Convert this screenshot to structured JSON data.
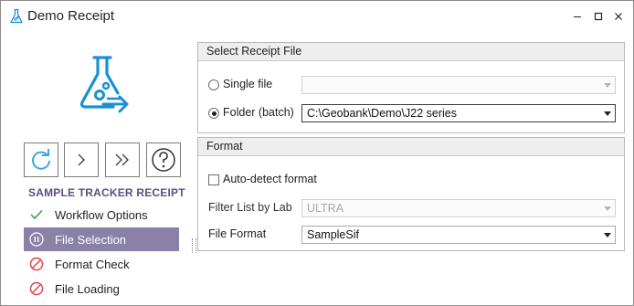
{
  "window": {
    "title": "Demo Receipt",
    "icon": "flask-icon",
    "controls": [
      "minimize",
      "maximize",
      "close"
    ]
  },
  "sidebar": {
    "toolbar_icons": [
      "refresh-icon",
      "next-icon",
      "fast-forward-icon",
      "help-icon"
    ],
    "section_title": "SAMPLE TRACKER RECEIPT",
    "steps": [
      {
        "label": "Workflow Options",
        "status": "done",
        "icon": "checkmark-icon"
      },
      {
        "label": "File Selection",
        "status": "active",
        "icon": "pause-icon"
      },
      {
        "label": "Format Check",
        "status": "blocked",
        "icon": "no-entry-icon"
      },
      {
        "label": "File Loading",
        "status": "blocked",
        "icon": "no-entry-icon"
      }
    ]
  },
  "receipt_file": {
    "header": "Select Receipt File",
    "single_file_label": "Single file",
    "single_file_value": "",
    "folder_label": "Folder (batch)",
    "folder_value": "C:\\Geobank\\Demo\\J22 series",
    "selected_mode": "folder"
  },
  "format": {
    "header": "Format",
    "auto_detect_label": "Auto-detect format",
    "auto_detect_checked": false,
    "filter_label": "Filter List by Lab",
    "filter_value": "ULTRA",
    "file_format_label": "File Format",
    "file_format_value": "SampleSif"
  },
  "colors": {
    "accent": "#8b80a8",
    "section_title": "#5d4f82",
    "logo_blue": "#1b8fd6",
    "check_green": "#3a9a3a",
    "blocked_red": "#e0413f"
  }
}
